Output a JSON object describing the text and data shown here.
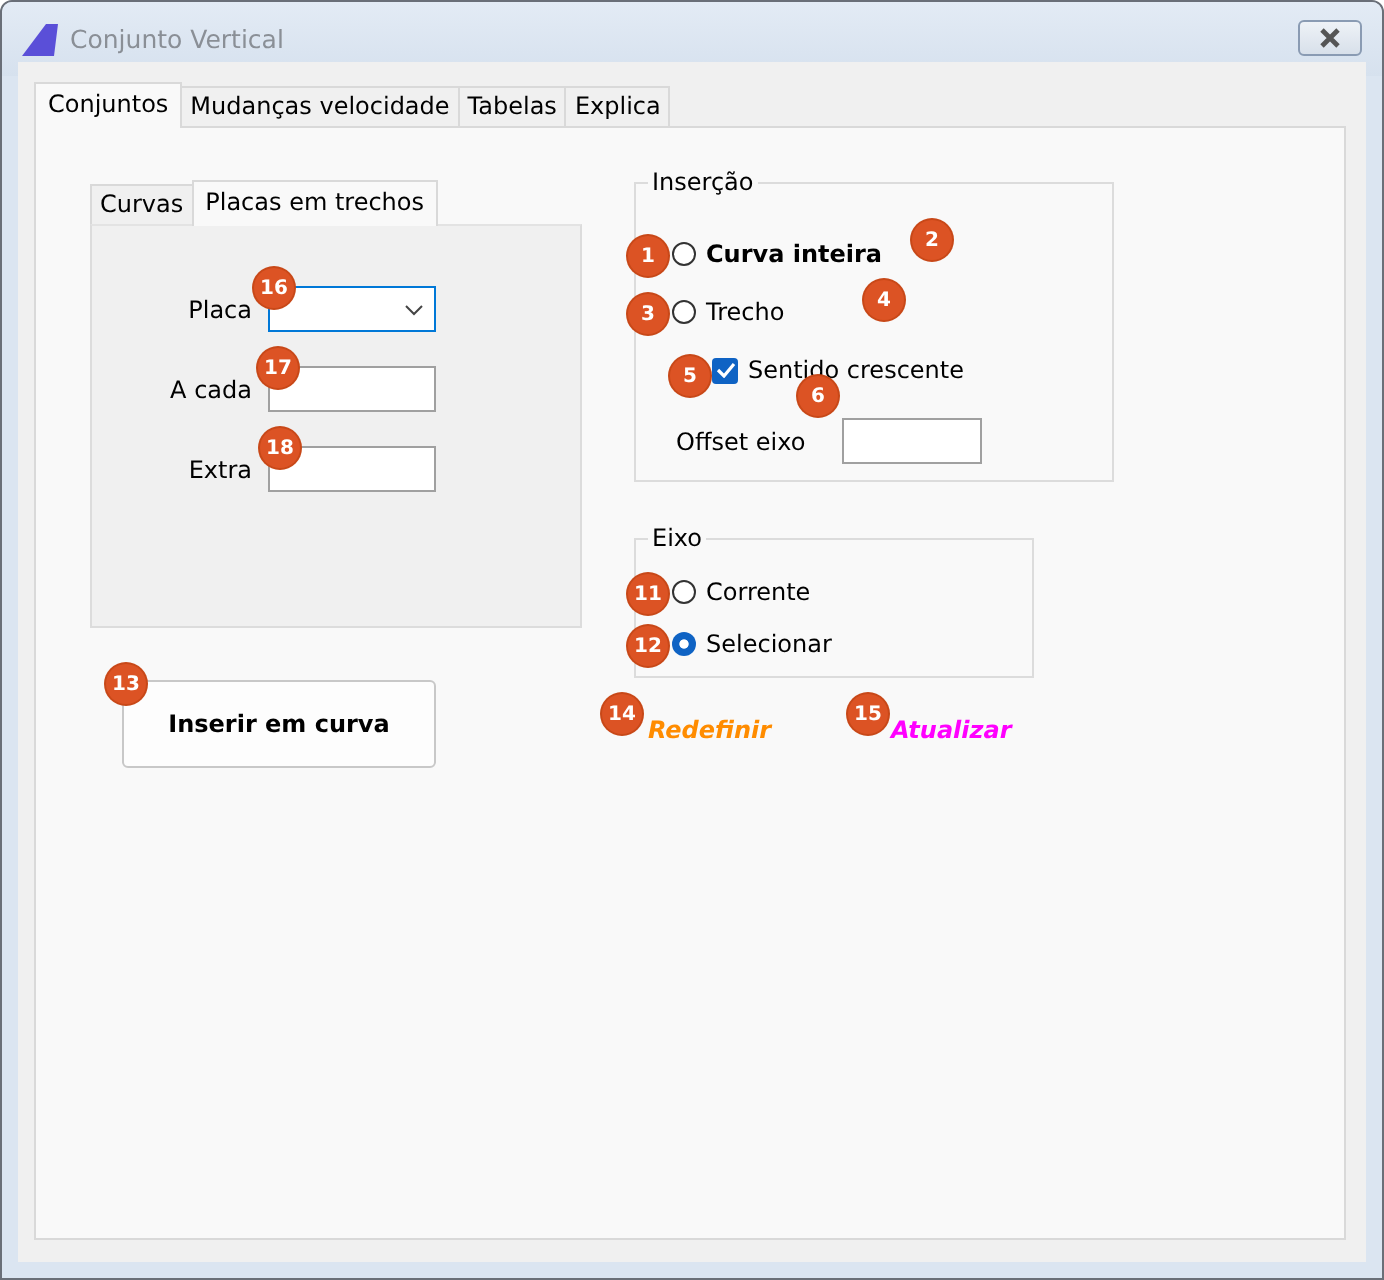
{
  "window": {
    "title": "Conjunto Vertical"
  },
  "tabs": [
    {
      "label": "Conjuntos",
      "selected": true
    },
    {
      "label": "Mudanças velocidade",
      "selected": false
    },
    {
      "label": "Tabelas",
      "selected": false
    },
    {
      "label": "Explica",
      "selected": false
    }
  ],
  "subtabs": [
    {
      "label": "Curvas",
      "selected": false
    },
    {
      "label": "Placas em trechos",
      "selected": true
    }
  ],
  "fields": [
    {
      "label": "Placa",
      "kind": "dropdown"
    },
    {
      "label": "A cada",
      "kind": "text"
    },
    {
      "label": "Extra",
      "kind": "text"
    }
  ],
  "insert_button": "Inserir em curva",
  "insercao": {
    "title": "Inserção",
    "options": [
      {
        "label": "Curva inteira",
        "selected": false,
        "bold": true
      },
      {
        "label": "Trecho",
        "selected": false,
        "bold": false
      }
    ],
    "checkbox": {
      "label": "Sentido crescente",
      "checked": true
    },
    "offset_label": "Offset eixo"
  },
  "eixo": {
    "title": "Eixo",
    "options": [
      {
        "label": "Corrente",
        "selected": false
      },
      {
        "label": "Selecionar",
        "selected": true
      }
    ]
  },
  "links": [
    {
      "label": "Redefinir",
      "color": "#ff8c00"
    },
    {
      "label": "Atualizar",
      "color": "#ff00ff"
    }
  ],
  "markers": [
    {
      "label": "1"
    },
    {
      "label": "2"
    },
    {
      "label": "3"
    },
    {
      "label": "4"
    },
    {
      "label": "5"
    },
    {
      "label": "6"
    },
    {
      "label": "11"
    },
    {
      "label": "12"
    },
    {
      "label": "13"
    },
    {
      "label": "14"
    },
    {
      "label": "15"
    },
    {
      "label": "16"
    },
    {
      "label": "17"
    },
    {
      "label": "18"
    }
  ]
}
